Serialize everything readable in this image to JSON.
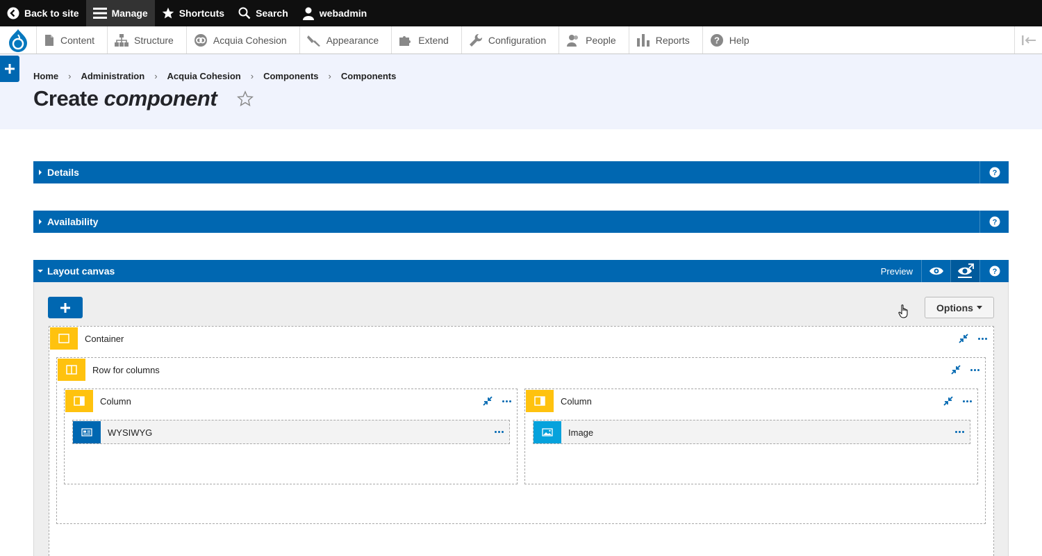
{
  "toolbar": {
    "back_label": "Back to site",
    "manage_label": "Manage",
    "shortcuts_label": "Shortcuts",
    "search_label": "Search",
    "user_label": "webadmin"
  },
  "tray": {
    "items": [
      {
        "label": "Content",
        "icon": "file-icon"
      },
      {
        "label": "Structure",
        "icon": "structure-icon"
      },
      {
        "label": "Acquia Cohesion",
        "icon": "cohesion-icon"
      },
      {
        "label": "Appearance",
        "icon": "brush-icon"
      },
      {
        "label": "Extend",
        "icon": "puzzle-icon"
      },
      {
        "label": "Configuration",
        "icon": "wrench-icon"
      },
      {
        "label": "People",
        "icon": "people-icon"
      },
      {
        "label": "Reports",
        "icon": "bar-chart-icon"
      },
      {
        "label": "Help",
        "icon": "help-icon"
      }
    ]
  },
  "breadcrumb": [
    "Home",
    "Administration",
    "Acquia Cohesion",
    "Components",
    "Components"
  ],
  "page": {
    "title_plain": "Create ",
    "title_italic": "component"
  },
  "sections": {
    "details": "Details",
    "availability": "Availability",
    "layout_canvas": "Layout canvas",
    "preview_label": "Preview"
  },
  "canvas": {
    "add_label": "+",
    "options_label": "Options",
    "container_label": "Container",
    "row_label": "Row for columns",
    "column_left_label": "Column",
    "column_right_label": "Column",
    "wysiwyg_label": "WYSIWYG",
    "image_label": "Image"
  },
  "colors": {
    "accent": "#0067b1",
    "element_yellow": "#ffc20e",
    "element_lightblue": "#06a2dc",
    "toolbar_bg": "#0f0f0f",
    "header_bg": "#f0f3fd"
  }
}
